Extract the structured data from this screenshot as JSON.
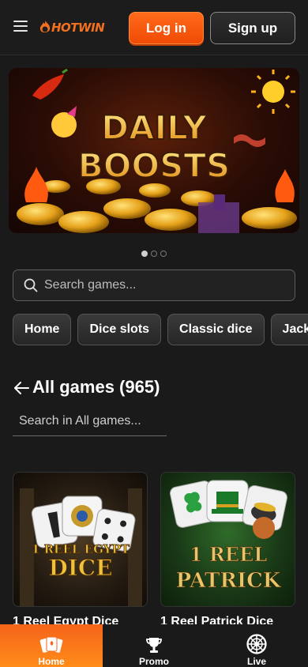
{
  "header": {
    "logo_text": "HOTWIN",
    "login_label": "Log in",
    "signup_label": "Sign up"
  },
  "banner": {
    "line1": "DAILY",
    "line2": "BOOSTS",
    "slide_count": 3,
    "active_slide": 1
  },
  "search": {
    "placeholder": "Search games..."
  },
  "categories": [
    {
      "label": "Home"
    },
    {
      "label": "Dice slots"
    },
    {
      "label": "Classic dice"
    },
    {
      "label": "Jackpot"
    }
  ],
  "section": {
    "title": "All games (965)",
    "filter_placeholder": "Search in All games..."
  },
  "games": [
    {
      "title": "1 Reel Egypt Dice",
      "art_line1": "1 REEL EGYPT",
      "art_line2": "DICE"
    },
    {
      "title": "1 Reel Patrick Dice",
      "art_line1": "1 REEL",
      "art_line2": "PATRICK"
    }
  ],
  "bottom_nav": [
    {
      "label": "Home",
      "icon": "cards-icon",
      "active": true
    },
    {
      "label": "Promo",
      "icon": "trophy-icon",
      "active": false
    },
    {
      "label": "Live",
      "icon": "roulette-icon",
      "active": false
    }
  ],
  "colors": {
    "accent": "#f5641a",
    "background": "#1a1a1a"
  }
}
